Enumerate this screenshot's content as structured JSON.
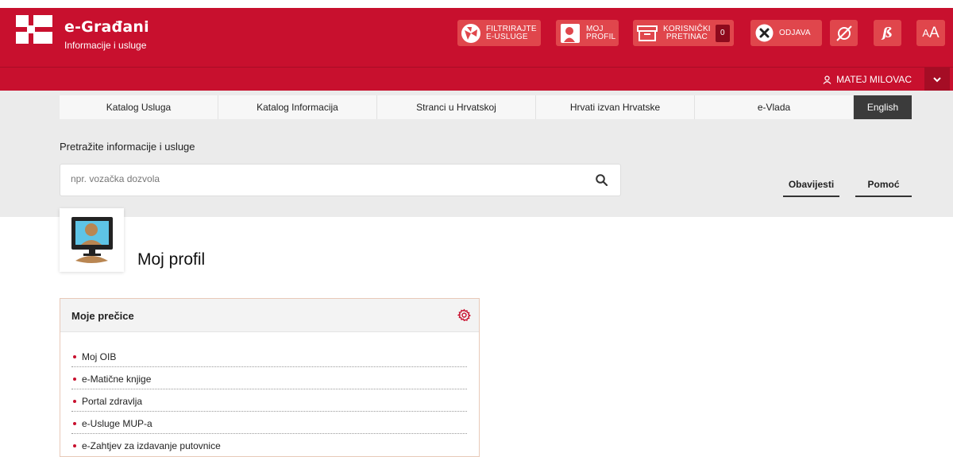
{
  "brand": {
    "title": "e-Građani",
    "subtitle": "Informacije i usluge",
    "color": "#c8102e"
  },
  "toolbar": {
    "filter_line1": "FILTRIRAJTE",
    "filter_line2": "E-USLUGE",
    "profile_line1": "MOJ",
    "profile_line2": "PROFIL",
    "inbox_line1": "KORISNIČKI",
    "inbox_line2": "PRETINAC",
    "inbox_count": "0",
    "logout": "ODJAVA",
    "font_size": "AA"
  },
  "user": {
    "name": "MATEJ MILOVAC"
  },
  "nav": {
    "items": [
      "Katalog Usluga",
      "Katalog Informacija",
      "Stranci u Hrvatskoj",
      "Hrvati izvan Hrvatske",
      "e-Vlada"
    ],
    "language": "English"
  },
  "search": {
    "title": "Pretražite informacije i usluge",
    "placeholder": "npr. vozačka dozvola",
    "notices": "Obavijesti",
    "help": "Pomoć"
  },
  "page": {
    "title": "Moj profil"
  },
  "shortcuts": {
    "title": "Moje prečice",
    "items": [
      "Moj OIB",
      "e-Matične knjige",
      "Portal zdravlja",
      "e-Usluge MUP-a",
      "e-Zahtjev za izdavanje putovnice"
    ]
  }
}
